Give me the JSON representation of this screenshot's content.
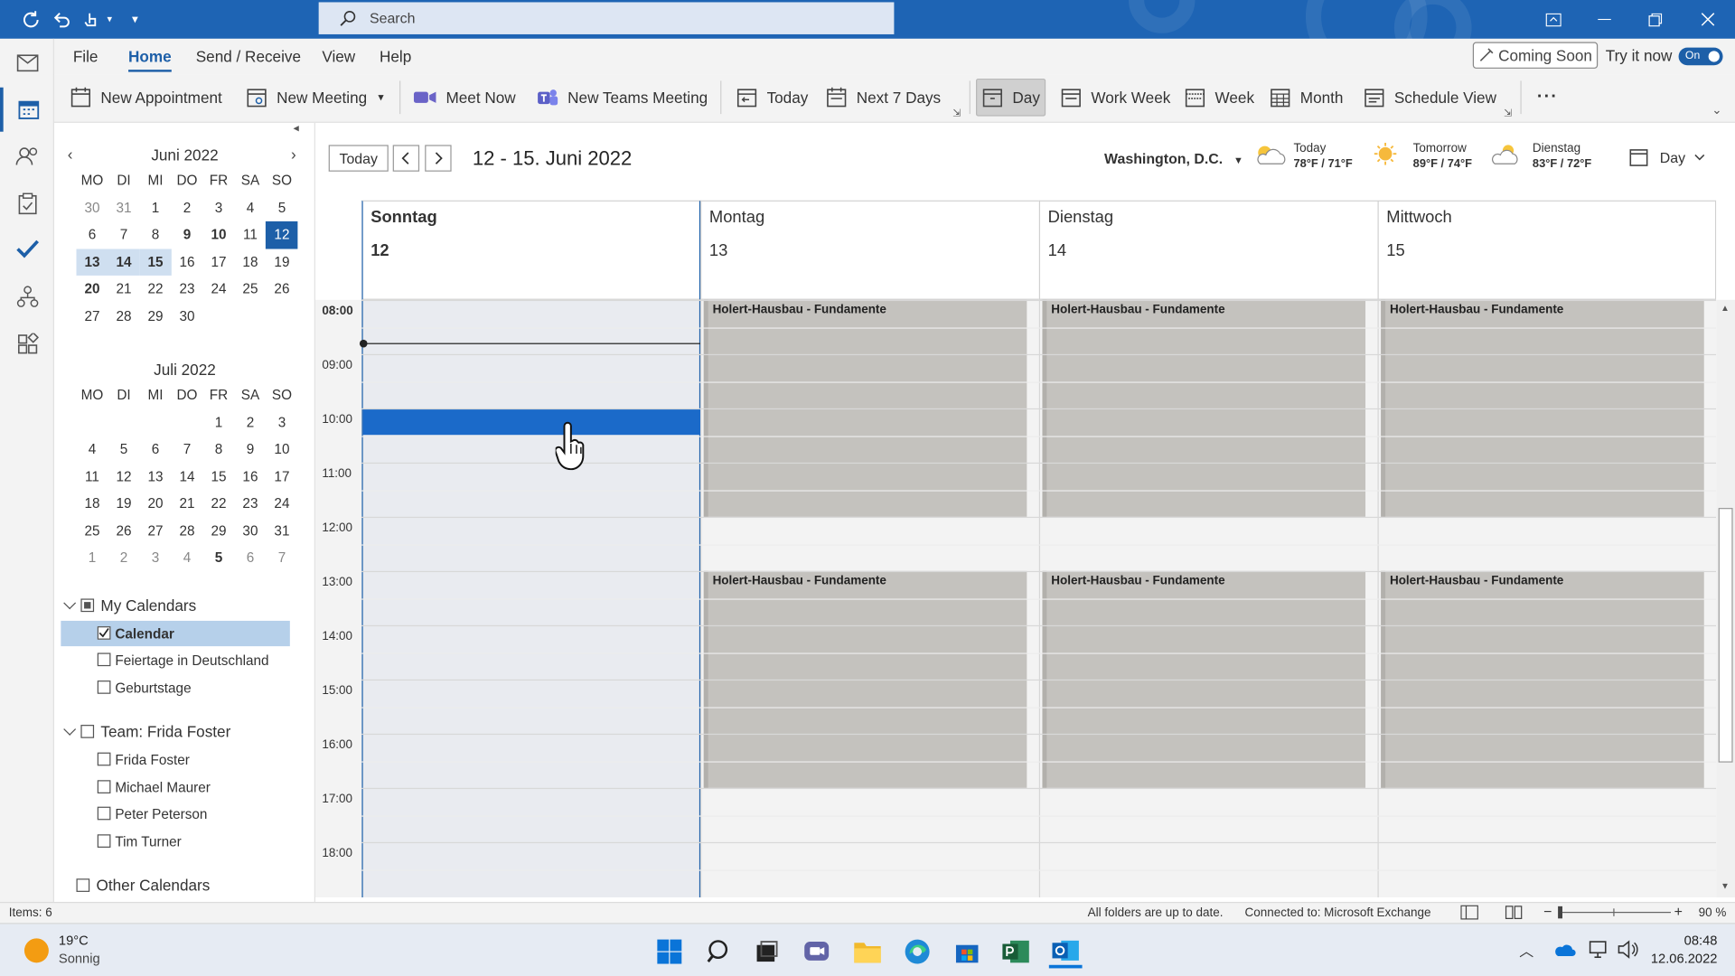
{
  "titlebar": {
    "search_placeholder": "Search"
  },
  "menu": {
    "tabs": [
      "File",
      "Home",
      "Send / Receive",
      "View",
      "Help"
    ],
    "coming_soon": "Coming Soon",
    "try_it_now": "Try it now",
    "toggle": "On"
  },
  "ribbon": {
    "new_appointment": "New Appointment",
    "new_meeting": "New Meeting",
    "meet_now": "Meet Now",
    "new_teams_meeting": "New Teams Meeting",
    "today": "Today",
    "next7": "Next 7 Days",
    "day": "Day",
    "work_week": "Work Week",
    "week": "Week",
    "month": "Month",
    "schedule_view": "Schedule View",
    "more": "···"
  },
  "minical": {
    "june_title": "Juni 2022",
    "july_title": "Juli 2022",
    "weekdays": [
      "MO",
      "DI",
      "MI",
      "DO",
      "FR",
      "SA",
      "SO"
    ],
    "june_weeks": [
      [
        "30",
        "31",
        "1",
        "2",
        "3",
        "4",
        "5"
      ],
      [
        "6",
        "7",
        "8",
        "9",
        "10",
        "11",
        "12"
      ],
      [
        "13",
        "14",
        "15",
        "16",
        "17",
        "18",
        "19"
      ],
      [
        "20",
        "21",
        "22",
        "23",
        "24",
        "25",
        "26"
      ],
      [
        "27",
        "28",
        "29",
        "30",
        "",
        "",
        ""
      ]
    ],
    "july_weeks": [
      [
        "",
        "",
        "",
        "",
        "1",
        "2",
        "3"
      ],
      [
        "4",
        "5",
        "6",
        "7",
        "8",
        "9",
        "10"
      ],
      [
        "11",
        "12",
        "13",
        "14",
        "15",
        "16",
        "17"
      ],
      [
        "18",
        "19",
        "20",
        "21",
        "22",
        "23",
        "24"
      ],
      [
        "25",
        "26",
        "27",
        "28",
        "29",
        "30",
        "31"
      ],
      [
        "1",
        "2",
        "3",
        "4",
        "5",
        "6",
        "7"
      ]
    ]
  },
  "calendars": {
    "my_calendars": "My Calendars",
    "calendar": "Calendar",
    "holidays": "Feiertage in Deutschland",
    "birthdays": "Geburtstage",
    "team": "Team: Frida Foster",
    "members": [
      "Frida Foster",
      "Michael Maurer",
      "Peter Peterson",
      "Tim Turner"
    ],
    "other": "Other Calendars"
  },
  "header": {
    "today_btn": "Today",
    "range": "12 - 15. Juni 2022",
    "location": "Washington, D.C.",
    "weather": [
      {
        "label": "Today",
        "temp": "78°F / 71°F"
      },
      {
        "label": "Tomorrow",
        "temp": "89°F / 74°F"
      },
      {
        "label": "Dienstag",
        "temp": "83°F / 72°F"
      }
    ],
    "view_select": "Day"
  },
  "days": [
    {
      "name": "Sonntag",
      "date": "12"
    },
    {
      "name": "Montag",
      "date": "13"
    },
    {
      "name": "Dienstag",
      "date": "14"
    },
    {
      "name": "Mittwoch",
      "date": "15"
    }
  ],
  "times": [
    "08:00",
    "09:00",
    "10:00",
    "11:00",
    "12:00",
    "13:00",
    "14:00",
    "15:00",
    "16:00",
    "17:00",
    "18:00"
  ],
  "event_title": "Holert-Hausbau - Fundamente",
  "status": {
    "items": "Items: 6",
    "sync": "All folders are up to date.",
    "connection": "Connected to: Microsoft Exchange",
    "zoom": "90 %"
  },
  "taskbar": {
    "temp": "19°C",
    "condition": "Sonnig",
    "time": "08:48",
    "date": "12.06.2022"
  },
  "colors": {
    "accent": "#1d5fa8",
    "event": "#c4c2be",
    "selection": "#1b6ac9"
  }
}
